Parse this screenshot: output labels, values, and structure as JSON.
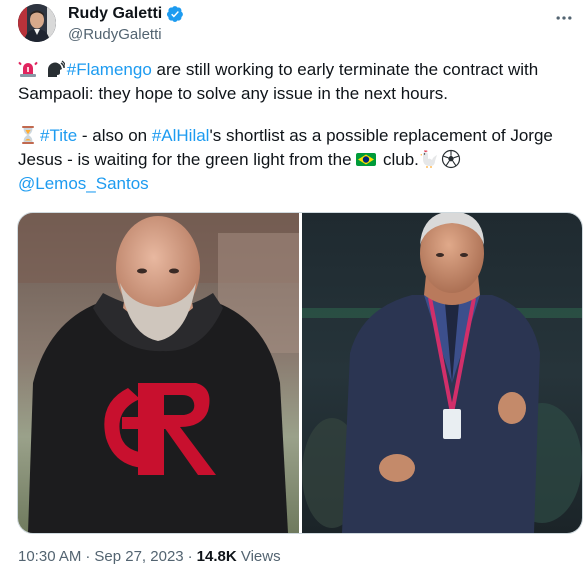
{
  "author": {
    "display_name": "Rudy Galetti",
    "handle": "@RudyGaletti",
    "verified_icon": "verified-badge-icon",
    "verified_color": "#1d9bf0"
  },
  "tweet": {
    "para1": {
      "emoji1": "rotating-light-emoji",
      "emoji2": "speaking-head-emoji",
      "hashtag": "#Flamengo",
      "text": " are still working to early terminate the contract with Sampaoli: they hope to solve any issue in the next hours."
    },
    "para2": {
      "emoji1": "hourglass-emoji",
      "hashtag1": "#Tite",
      "text1": " - also on ",
      "hashtag2": "#AlHilal",
      "text2": "'s shortlist as a possible replacement of Jorge Jesus - is waiting for the green light from the ",
      "flag": "brazil-flag-emoji",
      "text3": " club.",
      "emoji_end1": "rooster-emoji",
      "emoji_end2": "soccer-ball-emoji"
    },
    "mention": "@Lemos_Santos",
    "link_color": "#1d9bf0"
  },
  "media": {
    "photos": [
      "sampaoli-flamengo-hoodie-photo",
      "tite-suit-photo"
    ]
  },
  "meta": {
    "time": "10:30 AM",
    "separator": "·",
    "date": "Sep 27, 2023",
    "views_count": "14.8K",
    "views_label": " Views"
  }
}
